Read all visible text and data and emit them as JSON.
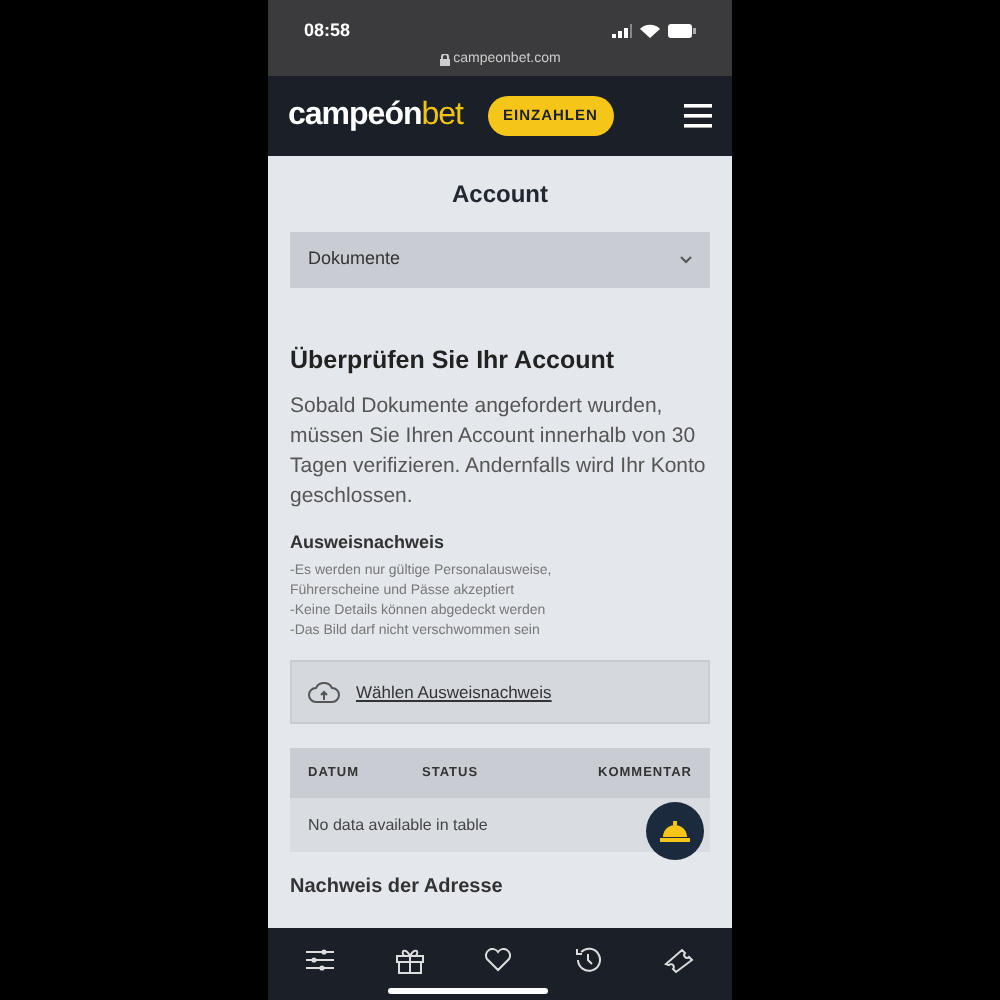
{
  "status_bar": {
    "time": "08:58",
    "url": "campeonbet.com"
  },
  "header": {
    "logo_main": "campeón",
    "logo_accent": "bet",
    "deposit_button": "EINZAHLEN"
  },
  "page_title": "Account",
  "dropdown": {
    "value": "Dokumente"
  },
  "verification": {
    "title": "Überprüfen Sie Ihr Account",
    "paragraph": "Sobald Dokumente angefordert wurden, müssen Sie Ihren Account innerhalb von 30 Tagen verifizieren. Andernfalls wird Ihr Konto geschlossen.",
    "subsection_title": "Ausweisnachweis",
    "requirements": [
      "-Es werden nur gültige Personalausweise, Führerscheine und Pässe akzeptiert",
      "-Keine Details können abgedeckt werden",
      "-Das Bild darf nicht verschwommen sein"
    ],
    "upload_label": "Wählen Ausweisnachweis"
  },
  "table": {
    "columns": [
      "DATUM",
      "STATUS",
      "KOMMENTAR"
    ],
    "empty_message": "No data available in table"
  },
  "next_section_title": "Nachweis der Adresse"
}
